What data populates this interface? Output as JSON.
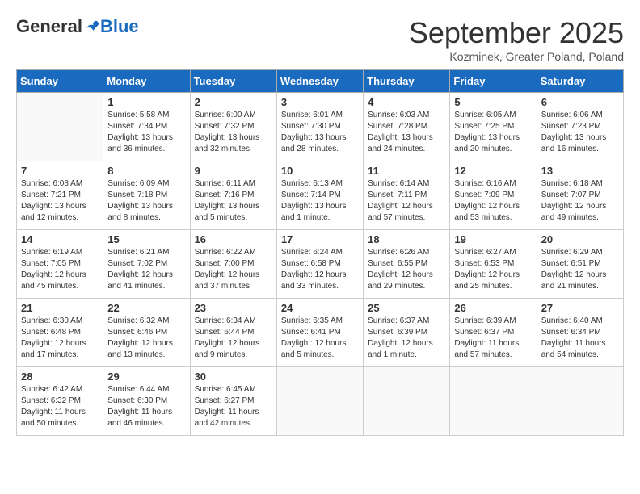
{
  "header": {
    "logo_general": "General",
    "logo_blue": "Blue",
    "month_title": "September 2025",
    "location": "Kozminek, Greater Poland, Poland"
  },
  "days_of_week": [
    "Sunday",
    "Monday",
    "Tuesday",
    "Wednesday",
    "Thursday",
    "Friday",
    "Saturday"
  ],
  "weeks": [
    [
      {
        "day": "",
        "info": ""
      },
      {
        "day": "1",
        "info": "Sunrise: 5:58 AM\nSunset: 7:34 PM\nDaylight: 13 hours and 36 minutes."
      },
      {
        "day": "2",
        "info": "Sunrise: 6:00 AM\nSunset: 7:32 PM\nDaylight: 13 hours and 32 minutes."
      },
      {
        "day": "3",
        "info": "Sunrise: 6:01 AM\nSunset: 7:30 PM\nDaylight: 13 hours and 28 minutes."
      },
      {
        "day": "4",
        "info": "Sunrise: 6:03 AM\nSunset: 7:28 PM\nDaylight: 13 hours and 24 minutes."
      },
      {
        "day": "5",
        "info": "Sunrise: 6:05 AM\nSunset: 7:25 PM\nDaylight: 13 hours and 20 minutes."
      },
      {
        "day": "6",
        "info": "Sunrise: 6:06 AM\nSunset: 7:23 PM\nDaylight: 13 hours and 16 minutes."
      }
    ],
    [
      {
        "day": "7",
        "info": "Sunrise: 6:08 AM\nSunset: 7:21 PM\nDaylight: 13 hours and 12 minutes."
      },
      {
        "day": "8",
        "info": "Sunrise: 6:09 AM\nSunset: 7:18 PM\nDaylight: 13 hours and 8 minutes."
      },
      {
        "day": "9",
        "info": "Sunrise: 6:11 AM\nSunset: 7:16 PM\nDaylight: 13 hours and 5 minutes."
      },
      {
        "day": "10",
        "info": "Sunrise: 6:13 AM\nSunset: 7:14 PM\nDaylight: 13 hours and 1 minute."
      },
      {
        "day": "11",
        "info": "Sunrise: 6:14 AM\nSunset: 7:11 PM\nDaylight: 12 hours and 57 minutes."
      },
      {
        "day": "12",
        "info": "Sunrise: 6:16 AM\nSunset: 7:09 PM\nDaylight: 12 hours and 53 minutes."
      },
      {
        "day": "13",
        "info": "Sunrise: 6:18 AM\nSunset: 7:07 PM\nDaylight: 12 hours and 49 minutes."
      }
    ],
    [
      {
        "day": "14",
        "info": "Sunrise: 6:19 AM\nSunset: 7:05 PM\nDaylight: 12 hours and 45 minutes."
      },
      {
        "day": "15",
        "info": "Sunrise: 6:21 AM\nSunset: 7:02 PM\nDaylight: 12 hours and 41 minutes."
      },
      {
        "day": "16",
        "info": "Sunrise: 6:22 AM\nSunset: 7:00 PM\nDaylight: 12 hours and 37 minutes."
      },
      {
        "day": "17",
        "info": "Sunrise: 6:24 AM\nSunset: 6:58 PM\nDaylight: 12 hours and 33 minutes."
      },
      {
        "day": "18",
        "info": "Sunrise: 6:26 AM\nSunset: 6:55 PM\nDaylight: 12 hours and 29 minutes."
      },
      {
        "day": "19",
        "info": "Sunrise: 6:27 AM\nSunset: 6:53 PM\nDaylight: 12 hours and 25 minutes."
      },
      {
        "day": "20",
        "info": "Sunrise: 6:29 AM\nSunset: 6:51 PM\nDaylight: 12 hours and 21 minutes."
      }
    ],
    [
      {
        "day": "21",
        "info": "Sunrise: 6:30 AM\nSunset: 6:48 PM\nDaylight: 12 hours and 17 minutes."
      },
      {
        "day": "22",
        "info": "Sunrise: 6:32 AM\nSunset: 6:46 PM\nDaylight: 12 hours and 13 minutes."
      },
      {
        "day": "23",
        "info": "Sunrise: 6:34 AM\nSunset: 6:44 PM\nDaylight: 12 hours and 9 minutes."
      },
      {
        "day": "24",
        "info": "Sunrise: 6:35 AM\nSunset: 6:41 PM\nDaylight: 12 hours and 5 minutes."
      },
      {
        "day": "25",
        "info": "Sunrise: 6:37 AM\nSunset: 6:39 PM\nDaylight: 12 hours and 1 minute."
      },
      {
        "day": "26",
        "info": "Sunrise: 6:39 AM\nSunset: 6:37 PM\nDaylight: 11 hours and 57 minutes."
      },
      {
        "day": "27",
        "info": "Sunrise: 6:40 AM\nSunset: 6:34 PM\nDaylight: 11 hours and 54 minutes."
      }
    ],
    [
      {
        "day": "28",
        "info": "Sunrise: 6:42 AM\nSunset: 6:32 PM\nDaylight: 11 hours and 50 minutes."
      },
      {
        "day": "29",
        "info": "Sunrise: 6:44 AM\nSunset: 6:30 PM\nDaylight: 11 hours and 46 minutes."
      },
      {
        "day": "30",
        "info": "Sunrise: 6:45 AM\nSunset: 6:27 PM\nDaylight: 11 hours and 42 minutes."
      },
      {
        "day": "",
        "info": ""
      },
      {
        "day": "",
        "info": ""
      },
      {
        "day": "",
        "info": ""
      },
      {
        "day": "",
        "info": ""
      }
    ]
  ]
}
